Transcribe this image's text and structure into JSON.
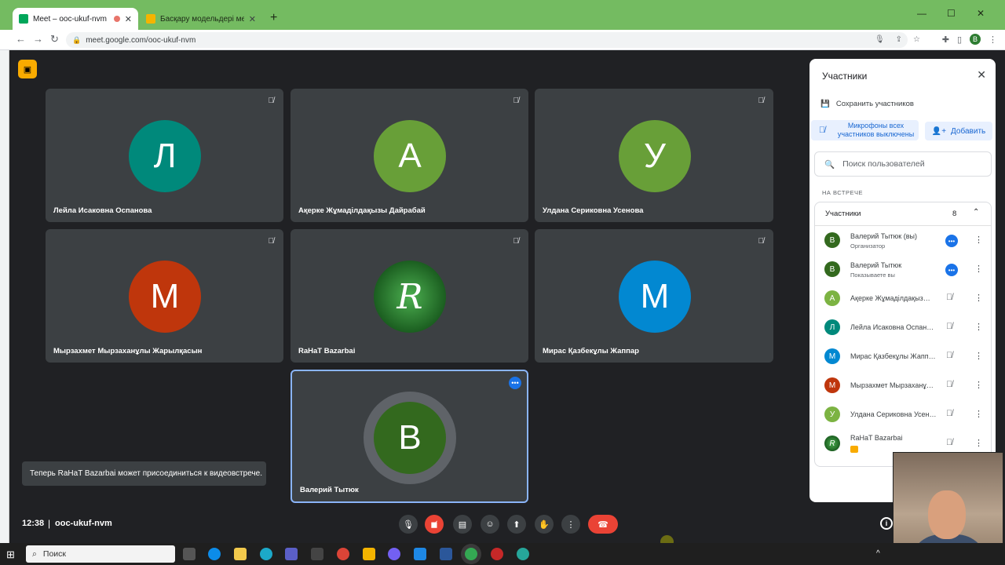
{
  "browser": {
    "tabs": [
      {
        "title": "Meet – ooc-ukuf-nvm"
      },
      {
        "title": "Басқару модельдері мен әдісте…"
      }
    ],
    "new_tab": "+",
    "url": "meet.google.com/ooc-ukuf-nvm",
    "profile_initial": "В",
    "window_controls": {
      "minimize": "—",
      "restore": "☐",
      "close": "✕"
    }
  },
  "tiles": [
    {
      "initial": "Л",
      "name": "Лейла Исаковна Оспанова",
      "color": "#00897b"
    },
    {
      "initial": "А",
      "name": "Ақерке Жұмаділдақызы Дайрабай",
      "color": "#689f38"
    },
    {
      "initial": "У",
      "name": "Улдана Сериковна Усенова",
      "color": "#689f38"
    },
    {
      "initial": "М",
      "name": "Мырзахмет Мырзаханұлы Жарылқасын",
      "color": "#bf360c"
    },
    {
      "initial": "R",
      "name": "RaHaT Bazarbai",
      "color": "#2e7d32"
    },
    {
      "initial": "М",
      "name": "Мирас Қазбекұлы Жаппар",
      "color": "#0288d1"
    },
    {
      "initial": "В",
      "name": "Валерий Тытюк",
      "color": "#33691e"
    }
  ],
  "toast": "Теперь RaHaT Bazarbai может присоединиться к видеовстрече.",
  "bottom": {
    "time": "12:38",
    "separator": "|",
    "code": "ooc-ukuf-nvm"
  },
  "panel": {
    "title": "Участники",
    "save": "Сохранить участников",
    "mute_all": "Микрофоны всех участников выключены",
    "add": "Добавить",
    "search_placeholder": "Поиск пользователей",
    "section": "НА ВСТРЕЧЕ",
    "group_label": "Участники",
    "count": "8",
    "participants": [
      {
        "initial": "В",
        "name": "Валерий Тытюк (вы)",
        "sub": "Организатор",
        "color": "#33691e"
      },
      {
        "initial": "В",
        "name": "Валерий Тытюк",
        "sub": "Показываете вы",
        "color": "#33691e"
      },
      {
        "initial": "А",
        "name": "Ақерке Жұмаділдақыз…",
        "sub": "",
        "color": "#7cb342"
      },
      {
        "initial": "Л",
        "name": "Лейла Исакoвна Оспан…",
        "sub": "",
        "color": "#00897b"
      },
      {
        "initial": "М",
        "name": "Мирас Қазбекұлы Жапп…",
        "sub": "",
        "color": "#0288d1"
      },
      {
        "initial": "М",
        "name": "Мырзахмет Мырзаханұ…",
        "sub": "",
        "color": "#bf360c"
      },
      {
        "initial": "У",
        "name": "Улдана Сериковна Усен…",
        "sub": "",
        "color": "#7cb342"
      },
      {
        "initial": "R",
        "name": "RaHaT Bazarbai",
        "sub": "",
        "color": "#2e7d32"
      }
    ]
  },
  "taskbar": {
    "search": "Поиск"
  }
}
